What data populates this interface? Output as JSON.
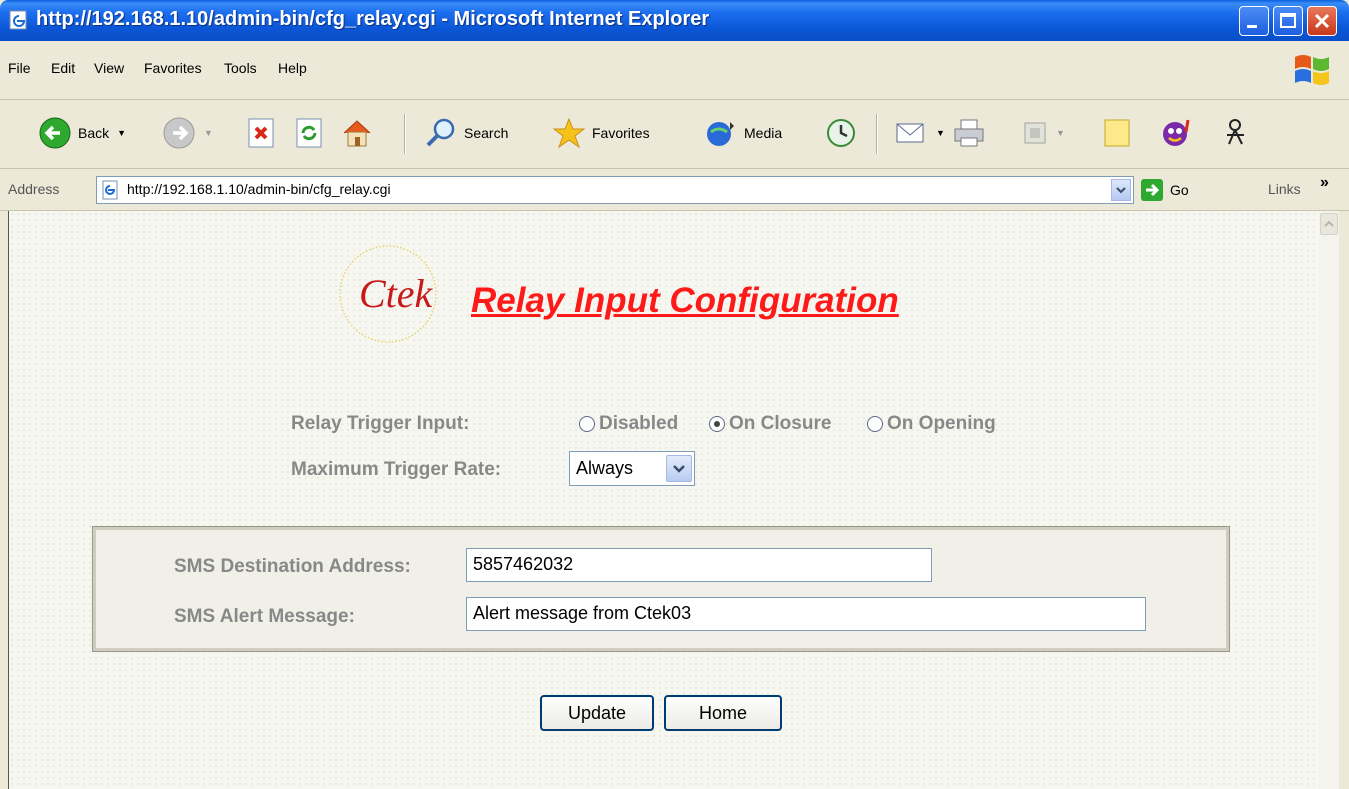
{
  "window": {
    "title": "http://192.168.1.10/admin-bin/cfg_relay.cgi - Microsoft Internet Explorer"
  },
  "menu": [
    "File",
    "Edit",
    "View",
    "Favorites",
    "Tools",
    "Help"
  ],
  "toolbar": {
    "back": "Back",
    "search": "Search",
    "favorites": "Favorites",
    "media": "Media"
  },
  "address": {
    "label": "Address",
    "url": "http://192.168.1.10/admin-bin/cfg_relay.cgi",
    "go": "Go",
    "links": "Links",
    "links_more": "»"
  },
  "page": {
    "logo_text": "Ctek",
    "title": "Relay Input Configuration",
    "relay_trigger_label": "Relay Trigger Input:",
    "radio_options": [
      "Disabled",
      "On Closure",
      "On Opening"
    ],
    "radio_selected": "On Closure",
    "max_rate_label": "Maximum Trigger Rate:",
    "max_rate_value": "Always",
    "sms_destination_label": "SMS Destination Address:",
    "sms_destination_value": "5857462032",
    "sms_message_label": "SMS Alert Message:",
    "sms_message_value": "Alert message from Ctek03",
    "update_button": "Update",
    "home_button": "Home"
  }
}
